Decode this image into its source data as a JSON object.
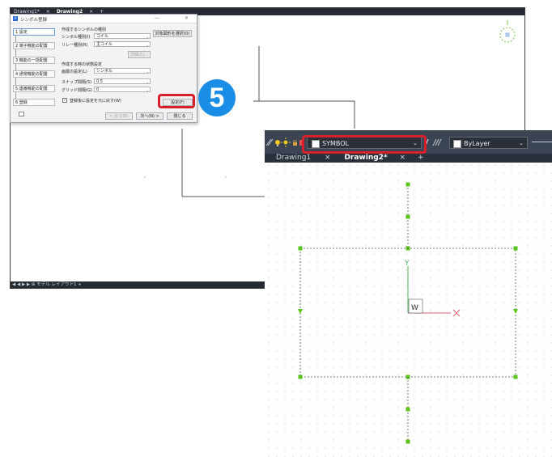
{
  "back_window": {
    "tabs": [
      "Drawing1*",
      "×",
      "Drawing2",
      "×",
      "+"
    ],
    "status": "◀ ◀ ▶ ▶ ⊞ モデル レイアウト1 +"
  },
  "dialog": {
    "title": "シンボル登録",
    "minimize": "—",
    "close": "✕",
    "steps": [
      "1 設定",
      "2 端子機能の配置",
      "3 機能の一括配置",
      "4 通常機能の配置",
      "5 連番機能の配置",
      "6 登録"
    ],
    "create_group_label": "作成するシンボルの種別",
    "symbol_type_label": "シンボル種別(I)",
    "symbol_type_value": "コイル",
    "relay_type_label": "リレー種別(R)",
    "relay_type_value": "主コイル",
    "detail_button": "詳細(E)...",
    "target_select_button": "対象図形を選択(O)",
    "create_settings_label": "作成する時の状態設定",
    "layer_setting_label": "画層の設定(L)",
    "layer_setting_value": "シンボル",
    "snap_label": "スナップ間隔(S)",
    "snap_value": "0.5",
    "grid_label": "グリッド間隔(G)",
    "grid_value": "0",
    "restore_check_label": "登録後に設定を元に戻す(W)",
    "settings_button": "設定(F)",
    "back_button": "< 戻る(B)",
    "next_button": "次へ(N) >",
    "close_button": "閉じる"
  },
  "badge": {
    "number": "5"
  },
  "front_window": {
    "layer_name": "SYMBOL",
    "linetype_value": "ByLayer",
    "tabs": [
      "Drawing1",
      "×",
      "Drawing2*",
      "×",
      "+"
    ],
    "ucs_y": "Y",
    "ucs_x": "X",
    "ucs_w": "W"
  },
  "colors": {
    "highlight": "#d8202b",
    "badge": "#1a8ee6",
    "grip": "#58c61b",
    "grid_dot": "#c9ccd1",
    "ucs_red": "#e06070",
    "ucs_green": "#4db85a",
    "toolbar_dark": "#3b4453"
  }
}
